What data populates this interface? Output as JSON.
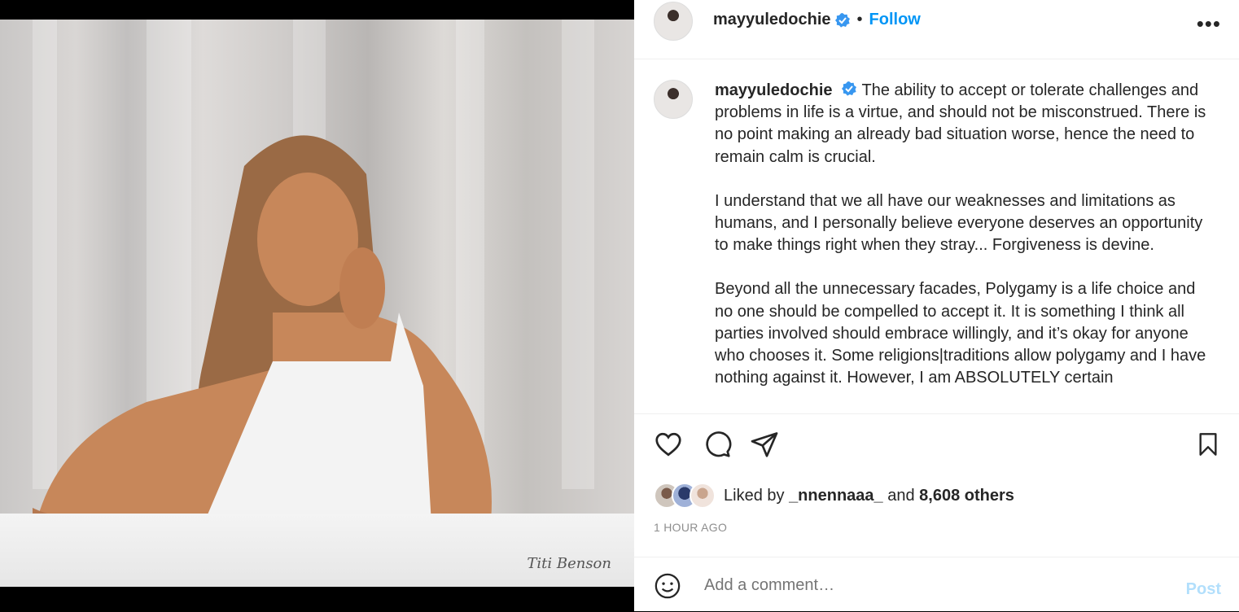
{
  "media": {
    "watermark": "Titi Benson"
  },
  "header": {
    "username": "mayyuledochie",
    "separator": "•",
    "follow_label": "Follow",
    "more_label": "•••"
  },
  "caption": {
    "username": "mayyuledochie",
    "paragraphs": [
      "The ability to accept or tolerate challenges and problems in life is a virtue, and should not be misconstrued. There is no point making an already bad situation worse, hence the need to remain calm is crucial.",
      "I understand that we all have our weaknesses and limitations as humans, and I personally believe everyone deserves an opportunity to make things right when they stray... Forgiveness is devine.",
      "Beyond all the unnecessary facades, Polygamy is a life choice and no one should be compelled to accept it. It is something I think all parties involved should embrace willingly, and it’s okay for anyone who chooses it. Some religions|traditions allow polygamy and I have nothing against it. However, I am ABSOLUTELY certain"
    ]
  },
  "likes": {
    "prefix": "Liked by",
    "liker": "_nnennaaa_",
    "and": "and",
    "others": "8,608 others"
  },
  "timestamp": "1 HOUR AGO",
  "comment": {
    "placeholder": "Add a comment…",
    "post_label": "Post"
  }
}
